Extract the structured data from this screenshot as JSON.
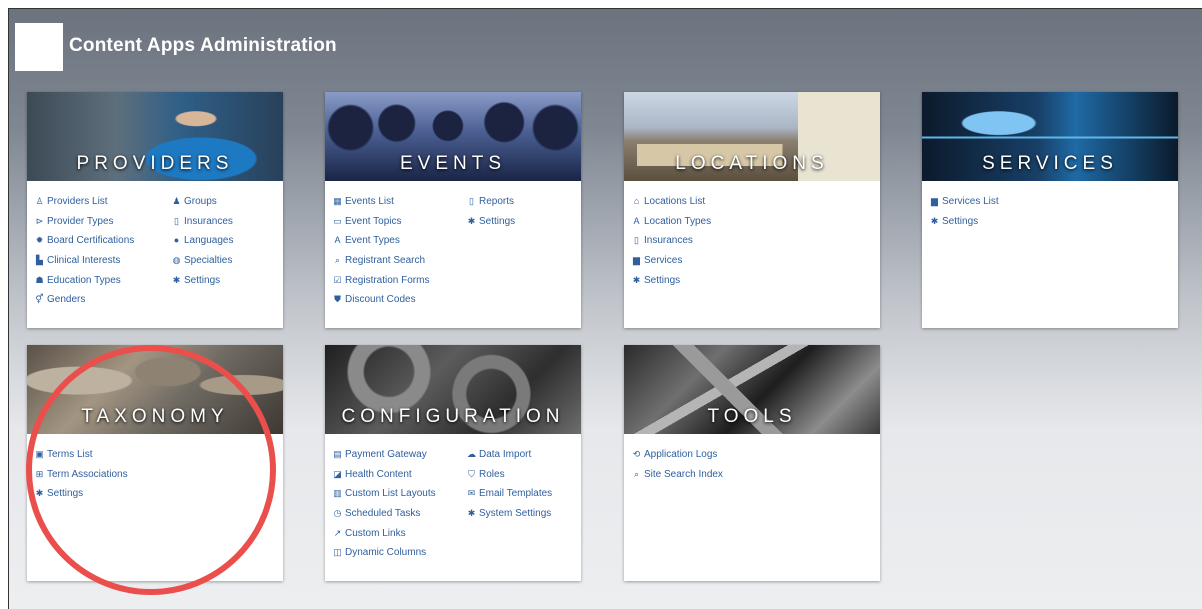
{
  "header": {
    "title": "Content Apps Administration"
  },
  "cards": {
    "providers": {
      "title": "PROVIDERS",
      "links": {
        "providers_list": "Providers List",
        "provider_types": "Provider Types",
        "board_certifications": "Board Certifications",
        "clinical_interests": "Clinical Interests",
        "education_types": "Education Types",
        "genders": "Genders",
        "groups": "Groups",
        "insurances": "Insurances",
        "languages": "Languages",
        "specialties": "Specialties",
        "settings": "Settings"
      }
    },
    "events": {
      "title": "EVENTS",
      "links": {
        "events_list": "Events List",
        "event_topics": "Event Topics",
        "event_types": "Event Types",
        "registrant_search": "Registrant Search",
        "registration_forms": "Registration Forms",
        "discount_codes": "Discount Codes",
        "reports": "Reports",
        "settings": "Settings"
      }
    },
    "locations": {
      "title": "LOCATIONS",
      "links": {
        "locations_list": "Locations List",
        "location_types": "Location Types",
        "insurances": "Insurances",
        "services": "Services",
        "settings": "Settings"
      }
    },
    "services": {
      "title": "SERVICES",
      "links": {
        "services_list": "Services List",
        "settings": "Settings"
      }
    },
    "taxonomy": {
      "title": "TAXONOMY",
      "links": {
        "terms_list": "Terms List",
        "term_associations": "Term Associations",
        "settings": "Settings"
      }
    },
    "configuration": {
      "title": "CONFIGURATION",
      "links": {
        "payment_gateway": "Payment Gateway",
        "health_content": "Health Content",
        "custom_list_layouts": "Custom List Layouts",
        "scheduled_tasks": "Scheduled Tasks",
        "custom_links": "Custom Links",
        "dynamic_columns": "Dynamic Columns",
        "data_import": "Data Import",
        "roles": "Roles",
        "email_templates": "Email Templates",
        "system_settings": "System Settings"
      }
    },
    "tools": {
      "title": "TOOLS",
      "links": {
        "application_logs": "Application Logs",
        "site_search_index": "Site Search Index"
      }
    }
  },
  "colors": {
    "link": "#2f5f9e",
    "highlight_circle": "#ea4f4c"
  }
}
